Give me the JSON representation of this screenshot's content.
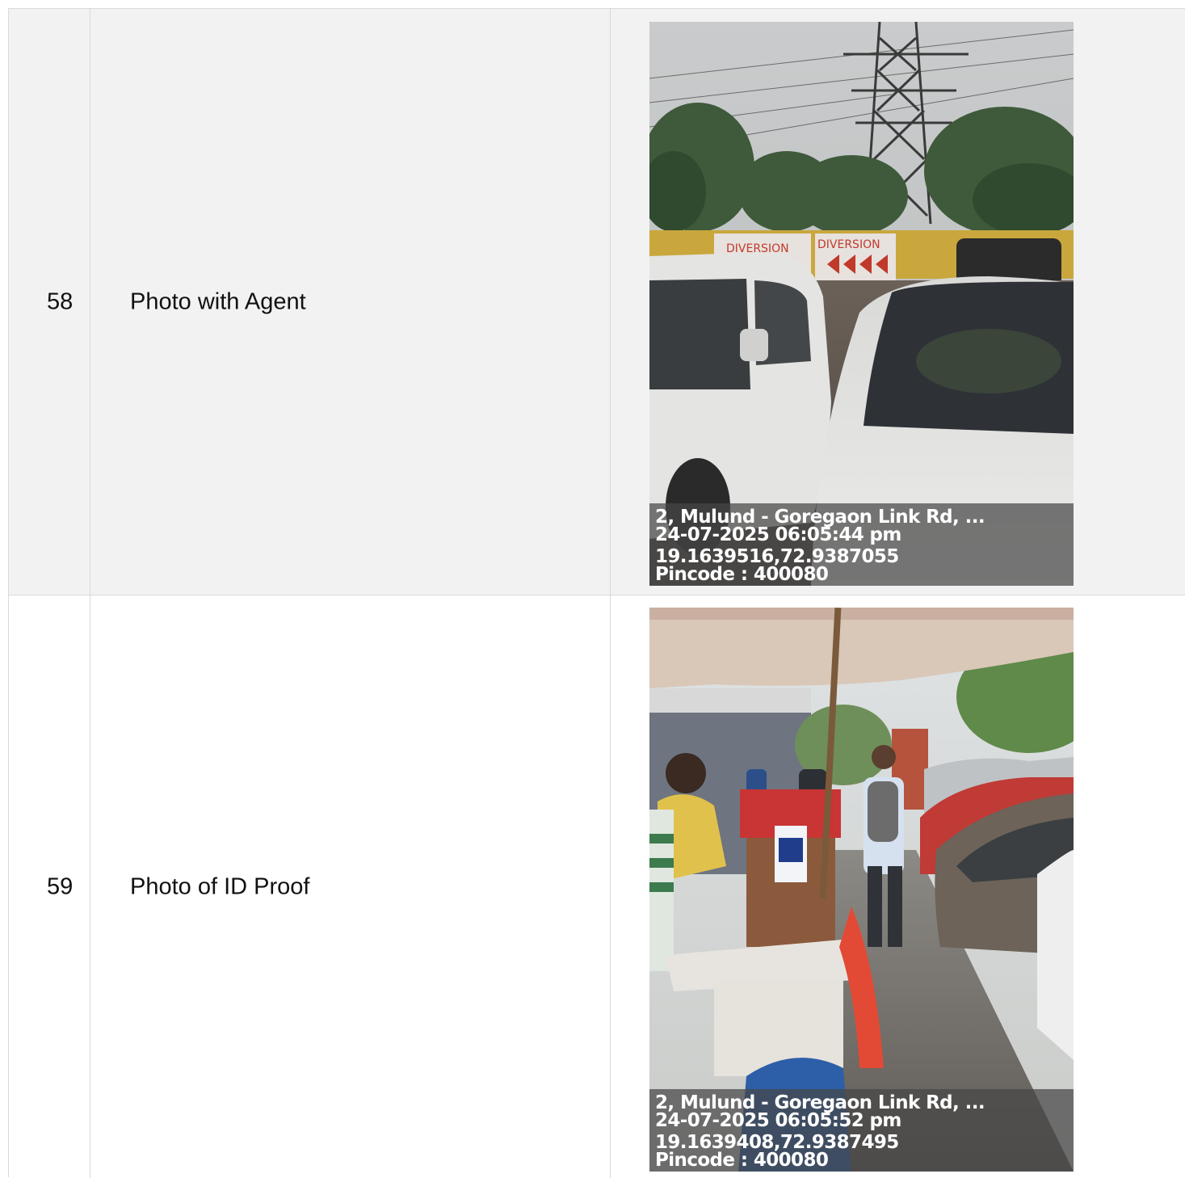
{
  "rows": [
    {
      "number": "58",
      "label": "Photo with Agent",
      "photo": {
        "address": "2, Mulund - Goregaon Link Rd, ...",
        "datetime": "24-07-2025 06:05:44 pm",
        "coordinates": "19.1639516,72.9387055",
        "pincode": "Pincode : 400080",
        "sign_text_1": "DIVERSION",
        "sign_text_2": "DIVERSION"
      }
    },
    {
      "number": "59",
      "label": "Photo of ID Proof",
      "photo": {
        "address": "2, Mulund - Goregaon Link Rd, ...",
        "datetime": "24-07-2025 06:05:52 pm",
        "coordinates": "19.1639408,72.9387495",
        "pincode": "Pincode : 400080"
      }
    }
  ]
}
